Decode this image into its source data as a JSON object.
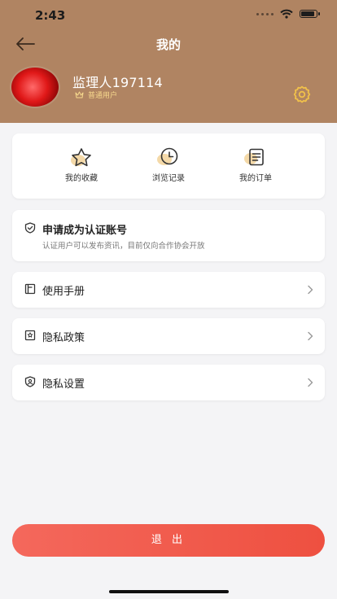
{
  "status_bar": {
    "time": "2:43"
  },
  "header": {
    "title": "我的",
    "user": {
      "name": "监理人197114",
      "role": "普通用户"
    }
  },
  "quick_actions": [
    {
      "label": "我的收藏",
      "icon": "star-icon"
    },
    {
      "label": "浏览记录",
      "icon": "clock-icon"
    },
    {
      "label": "我的订单",
      "icon": "order-list-icon"
    }
  ],
  "apply_card": {
    "title": "申请成为认证账号",
    "subtitle": "认证用户可以发布资讯，目前仅向合作协会开放"
  },
  "menu": [
    {
      "label": "使用手册",
      "icon": "book-icon"
    },
    {
      "label": "隐私政策",
      "icon": "privacy-policy-icon"
    },
    {
      "label": "隐私设置",
      "icon": "shield-user-icon"
    }
  ],
  "logout_label": "退 出",
  "colors": {
    "header_bg": "#b08462",
    "accent_gold": "#f0c04a",
    "logout": "#f05a4c"
  }
}
